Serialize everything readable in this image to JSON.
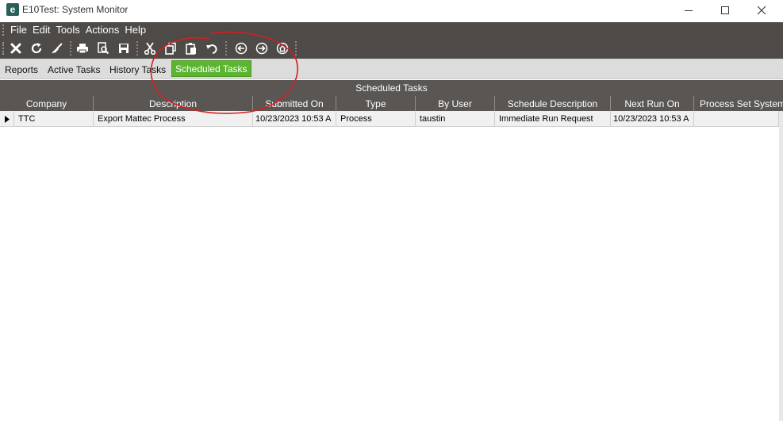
{
  "window": {
    "app_icon_letter": "e",
    "title": "E10Test: System Monitor"
  },
  "menu": {
    "items": [
      "File",
      "Edit",
      "Tools",
      "Actions",
      "Help"
    ]
  },
  "toolbar": {
    "icons": [
      "delete-icon",
      "refresh-icon",
      "clear-icon",
      "print-icon",
      "print-preview-icon",
      "save-icon",
      "cut-icon",
      "copy-icon",
      "paste-icon",
      "undo-icon",
      "back-icon",
      "forward-icon",
      "home-icon"
    ]
  },
  "tabs": {
    "items": [
      "Reports",
      "Active Tasks",
      "History Tasks",
      "Scheduled Tasks"
    ],
    "active": "Scheduled Tasks"
  },
  "grid": {
    "title": "Scheduled Tasks",
    "columns": [
      "Company",
      "Description",
      "Submitted On",
      "Type",
      "By User",
      "Schedule Description",
      "Next Run On",
      "Process Set System"
    ],
    "rows": [
      [
        "TTC",
        "Export Mattec Process",
        "10/23/2023 10:53 A",
        "Process",
        "taustin",
        "Immediate Run Request",
        "10/23/2023 10:53 A",
        ""
      ]
    ]
  },
  "colors": {
    "chrome_dark": "#4d4a47",
    "active_tab": "#5cb531",
    "annotation": "#d81e1e"
  }
}
